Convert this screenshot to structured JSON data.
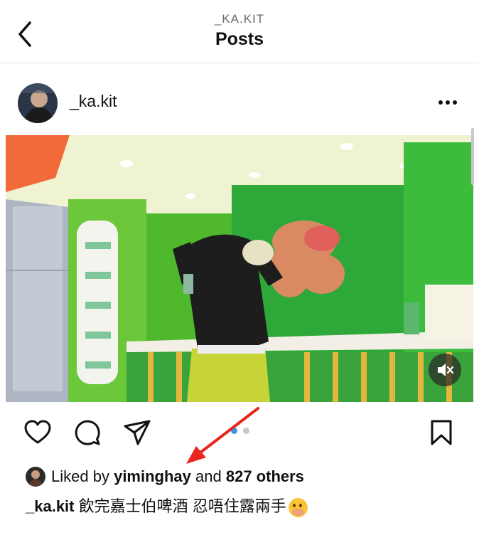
{
  "header": {
    "subtitle": "_KA.KIT",
    "title": "Posts",
    "back_icon": "chevron-left-icon"
  },
  "post": {
    "username": "_ka.kit",
    "more_icon": "ellipsis-icon",
    "mute_icon": "speaker-muted-icon",
    "actions": [
      "heart-icon",
      "comment-icon",
      "share-icon",
      "bookmark-icon"
    ],
    "carousel": {
      "count": 2,
      "active": 1,
      "active_color": "#3897f0",
      "inactive_color": "#c7c7c7"
    },
    "likes": {
      "prefix": "Liked by",
      "user": "yiminghay",
      "connector": "and",
      "others": "827 others"
    },
    "caption": {
      "user": "_ka.kit",
      "text": "飲完嘉士伯啤酒 忍唔住露兩手",
      "emoji": "hand-over-mouth-emoji"
    }
  },
  "annotation": {
    "color": "#e8261e"
  }
}
